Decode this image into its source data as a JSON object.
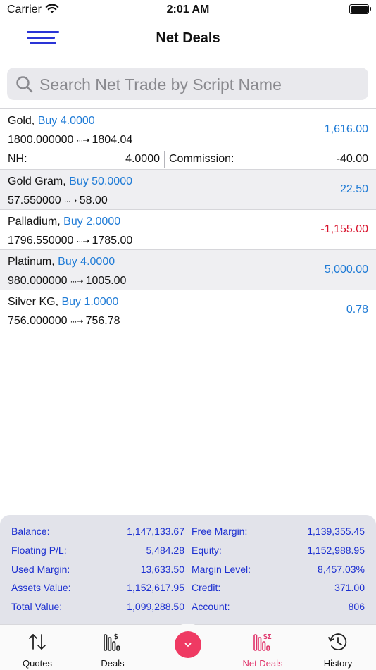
{
  "status_bar": {
    "carrier": "Carrier",
    "time": "2:01 AM"
  },
  "nav": {
    "title": "Net Deals",
    "menu_icon": "hamburger-menu-icon"
  },
  "search": {
    "placeholder": "Search Net Trade by Script Name",
    "value": ""
  },
  "deals": [
    {
      "name": "Gold,",
      "side": "Buy 4.0000",
      "open": "1800.000000",
      "current": "1804.04",
      "amount": "1,616.00",
      "amount_color": "#1f7bd6",
      "nh_label": "NH:",
      "nh_value": "4.0000",
      "commission_label": "Commission:",
      "commission_value": "-40.00"
    },
    {
      "name": "Gold Gram,",
      "side": "Buy 50.0000",
      "open": "57.550000",
      "current": "58.00",
      "amount": "22.50",
      "amount_color": "#1f7bd6"
    },
    {
      "name": "Palladium,",
      "side": "Buy 2.0000",
      "open": "1796.550000",
      "current": "1785.00",
      "amount": "-1,155.00",
      "amount_color": "#d8102a"
    },
    {
      "name": "Platinum,",
      "side": "Buy 4.0000",
      "open": "980.000000",
      "current": "1005.00",
      "amount": "5,000.00",
      "amount_color": "#1f7bd6"
    },
    {
      "name": "Silver KG,",
      "side": "Buy 1.0000",
      "open": "756.000000",
      "current": "756.78",
      "amount": "0.78",
      "amount_color": "#1f7bd6"
    }
  ],
  "arrow_glyph": "···➝",
  "summary": {
    "balance_label": "Balance:",
    "balance": "1,147,133.67",
    "free_margin_label": "Free Margin:",
    "free_margin": "1,139,355.45",
    "floating_label": "Floating P/L:",
    "floating": "5,484.28",
    "equity_label": "Equity:",
    "equity": "1,152,988.95",
    "used_margin_label": "Used Margin:",
    "used_margin": "13,633.50",
    "margin_level_label": "Margin Level:",
    "margin_level": "8,457.03%",
    "assets_label": "Assets Value:",
    "assets": "1,152,617.95",
    "credit_label": "Credit:",
    "credit": "371.00",
    "total_label": "Total Value:",
    "total": "1,099,288.50",
    "account_label": "Account:",
    "account": "806"
  },
  "tabs": [
    {
      "label": "Quotes",
      "icon": "up-down-arrows-icon"
    },
    {
      "label": "Deals",
      "icon": "deals-bars-icon"
    },
    {
      "label": "Net Deals",
      "icon": "net-deals-bars-icon",
      "active": true
    },
    {
      "label": "History",
      "icon": "history-clock-icon"
    }
  ],
  "fab_icon": "chevron-down-icon",
  "colors": {
    "accent": "#1f7bd6",
    "negative": "#d8102a",
    "summary_text": "#1c2fd0",
    "active_tab": "#e0336a",
    "fab": "#ef3a63",
    "menu": "#2a34d6"
  }
}
